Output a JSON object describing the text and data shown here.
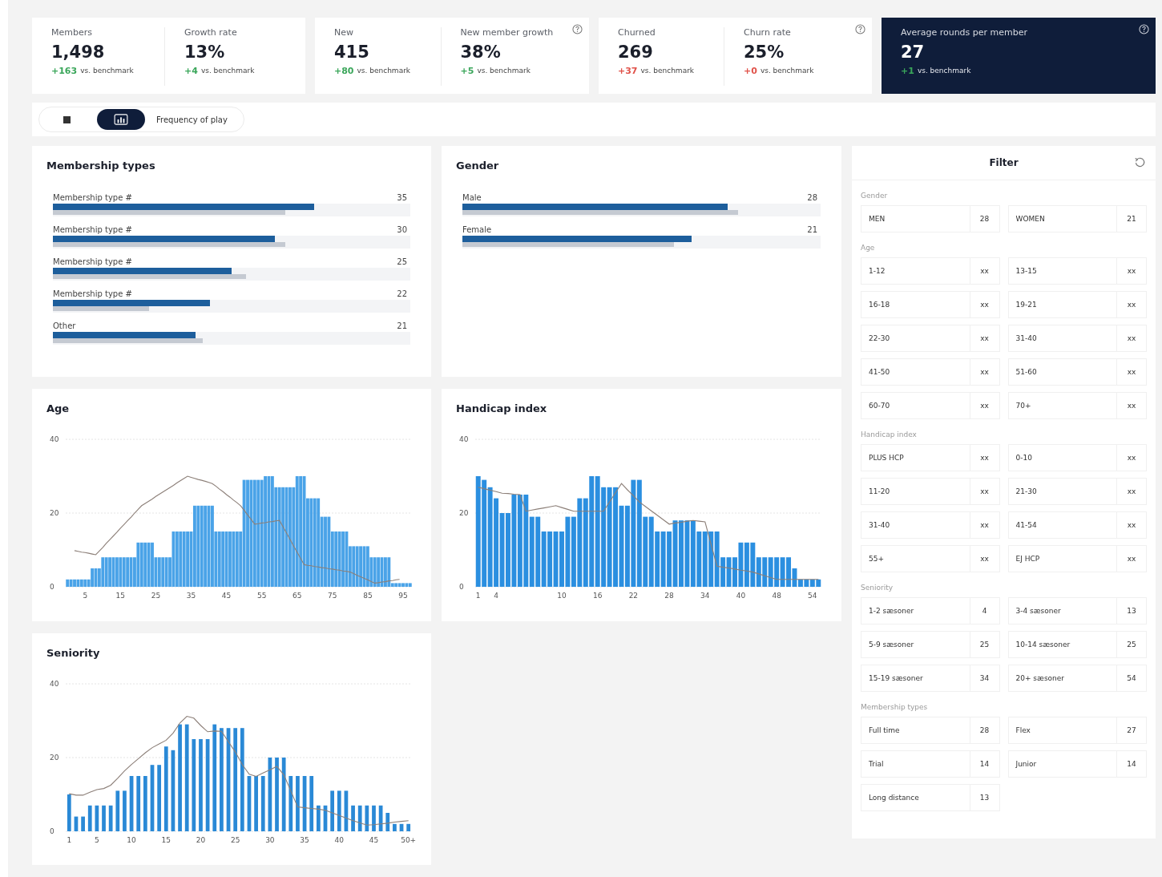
{
  "kpi_cards": [
    {
      "dark": false,
      "info": false,
      "metrics": [
        {
          "label": "Members",
          "value": "1,498",
          "delta": "+163",
          "color": "#3aa65a",
          "caption": "vs. benchmark"
        },
        {
          "label": "Growth rate",
          "value": "13%",
          "delta": "+4",
          "color": "#3aa65a",
          "caption": "vs. benchmark"
        }
      ]
    },
    {
      "dark": false,
      "info": true,
      "metrics": [
        {
          "label": "New",
          "value": "415",
          "delta": "+80",
          "color": "#3aa65a",
          "caption": "vs. benchmark"
        },
        {
          "label": "New member growth",
          "value": "38%",
          "delta": "+5",
          "color": "#3aa65a",
          "caption": "vs. benchmark"
        }
      ]
    },
    {
      "dark": false,
      "info": true,
      "metrics": [
        {
          "label": "Churned",
          "value": "269",
          "delta": "+37",
          "color": "#e0524a",
          "caption": "vs. benchmark"
        },
        {
          "label": "Churn rate",
          "value": "25%",
          "delta": "+0",
          "color": "#e0524a",
          "caption": "vs. benchmark"
        }
      ]
    },
    {
      "dark": true,
      "info": true,
      "metrics": [
        {
          "label": "Average rounds per member",
          "value": "27",
          "delta": "+1",
          "color": "#3aa65a",
          "caption": "vs. benchmark"
        }
      ]
    }
  ],
  "view_tabs": [
    {
      "kind": "list-icon",
      "selected": false
    },
    {
      "kind": "chart-icon",
      "selected": true
    },
    {
      "kind": "text",
      "label": "Frequency of play",
      "selected": false
    }
  ],
  "membership_types": {
    "title": "Membership types",
    "rows": [
      {
        "label": "Membership type #",
        "value": "35",
        "bars": [
          {
            "kind": "current",
            "level": 0.73
          },
          {
            "kind": "benchmark",
            "level": 0.65
          }
        ]
      },
      {
        "label": "Membership type #",
        "value": "30",
        "bars": [
          {
            "kind": "current",
            "level": 0.62
          },
          {
            "kind": "benchmark",
            "level": 0.65
          }
        ]
      },
      {
        "label": "Membership type #",
        "value": "25",
        "bars": [
          {
            "kind": "current",
            "level": 0.5
          },
          {
            "kind": "benchmark",
            "level": 0.54
          }
        ]
      },
      {
        "label": "Membership type #",
        "value": "22",
        "bars": [
          {
            "kind": "current",
            "level": 0.44
          },
          {
            "kind": "benchmark",
            "level": 0.27
          }
        ]
      },
      {
        "label": "Other",
        "value": "21",
        "bars": [
          {
            "kind": "current",
            "level": 0.4
          },
          {
            "kind": "benchmark",
            "level": 0.42
          }
        ]
      }
    ]
  },
  "gender": {
    "title": "Gender",
    "rows": [
      {
        "label": "Male",
        "value": "28",
        "bars": [
          {
            "kind": "current",
            "level": 0.74
          },
          {
            "kind": "benchmark",
            "level": 0.77
          }
        ]
      },
      {
        "label": "Female",
        "value": "21",
        "bars": [
          {
            "kind": "current",
            "level": 0.64
          },
          {
            "kind": "benchmark",
            "level": 0.59
          }
        ]
      }
    ]
  },
  "age": {
    "title": "Age",
    "chart_data": {
      "type": "bar",
      "xlim": [
        -0.5,
        97.5
      ],
      "ylim": [
        0,
        40
      ],
      "yticks": [
        0,
        20,
        40
      ],
      "xticks": [
        5,
        15,
        25,
        35,
        45,
        55,
        65,
        75,
        85,
        95
      ],
      "x": [
        0,
        1,
        2,
        3,
        4,
        5,
        6,
        7,
        8,
        9,
        10,
        11,
        12,
        13,
        14,
        15,
        16,
        17,
        18,
        19,
        20,
        21,
        22,
        23,
        24,
        25,
        26,
        27,
        28,
        29,
        30,
        31,
        32,
        33,
        34,
        35,
        36,
        37,
        38,
        39,
        40,
        41,
        42,
        43,
        44,
        45,
        46,
        47,
        48,
        49,
        50,
        51,
        52,
        53,
        54,
        55,
        56,
        57,
        58,
        59,
        60,
        61,
        62,
        63,
        64,
        65,
        66,
        67,
        68,
        69,
        70,
        71,
        72,
        73,
        74,
        75,
        76,
        77,
        78,
        79,
        80,
        81,
        82,
        83,
        84,
        85,
        86,
        87,
        88,
        89,
        90,
        91,
        92,
        93,
        94,
        95,
        96,
        97
      ],
      "series": [
        {
          "type": "bar",
          "color": "#4aa3e8",
          "values": [
            2,
            2,
            2,
            2,
            2,
            2,
            2,
            5,
            5,
            5,
            8,
            8,
            8,
            8,
            8,
            8,
            8,
            8,
            8,
            8,
            12,
            12,
            12,
            12,
            12,
            8,
            8,
            8,
            8,
            8,
            15,
            15,
            15,
            15,
            15,
            15,
            22,
            22,
            22,
            22,
            22,
            22,
            15,
            15,
            15,
            15,
            15,
            15,
            15,
            15,
            29,
            29,
            29,
            29,
            29,
            29,
            30,
            30,
            30,
            27,
            27,
            27,
            27,
            27,
            27,
            30,
            30,
            30,
            24,
            24,
            24,
            24,
            19,
            19,
            19,
            15,
            15,
            15,
            15,
            15,
            11,
            11,
            11,
            11,
            11,
            11,
            8,
            8,
            8,
            8,
            8,
            8,
            1,
            1,
            1,
            1,
            1,
            1
          ]
        },
        {
          "type": "line",
          "color": "#8c7f78",
          "values": [
            null,
            null,
            9.8,
            9.6,
            9.4,
            9.3,
            9.1,
            8.9,
            8.7,
            9.7,
            10.7,
            11.8,
            12.8,
            13.8,
            14.8,
            15.9,
            16.9,
            17.9,
            18.9,
            20,
            21,
            22,
            22.6,
            23.2,
            23.8,
            24.5,
            25.1,
            25.7,
            26.3,
            26.9,
            27.5,
            28.2,
            28.8,
            29.4,
            30,
            29.7,
            29.4,
            29.1,
            28.9,
            28.6,
            28.3,
            28,
            27.3,
            26.5,
            25.8,
            25,
            24.3,
            23.5,
            22.8,
            22,
            20.8,
            19.5,
            18.3,
            17,
            17.1,
            17.3,
            17.4,
            17.6,
            17.7,
            17.9,
            18,
            16.3,
            14.6,
            12.9,
            11.1,
            9.4,
            7.7,
            6,
            5.8,
            5.7,
            5.5,
            5.4,
            5.2,
            5.1,
            4.9,
            4.8,
            4.6,
            4.5,
            4.3,
            4.2,
            4,
            3.6,
            3.1,
            2.7,
            2.3,
            1.9,
            1.4,
            1,
            1.1,
            1.3,
            1.4,
            1.6,
            1.7,
            1.9,
            2,
            null,
            null,
            null
          ]
        }
      ]
    }
  },
  "handicap_index": {
    "title": "Handicap index",
    "chart_data": {
      "type": "bar",
      "ylim": [
        0,
        40
      ],
      "yticks": [
        0,
        20,
        40
      ],
      "categories": [
        "1",
        null,
        null,
        "4",
        null,
        null,
        null,
        null,
        null,
        null,
        null,
        null,
        null,
        null,
        "10",
        null,
        null,
        null,
        null,
        null,
        "16",
        null,
        null,
        null,
        null,
        null,
        "22",
        null,
        null,
        null,
        null,
        null,
        "28",
        null,
        null,
        null,
        null,
        null,
        "34",
        null,
        null,
        null,
        null,
        null,
        "40",
        null,
        null,
        null,
        null,
        null,
        "48",
        null,
        null,
        null,
        null,
        null,
        "54",
        null
      ],
      "series": [
        {
          "type": "bar",
          "color": "#2b8fe0",
          "values": [
            30,
            29,
            27,
            24,
            20,
            20,
            25,
            25,
            25,
            19,
            19,
            15,
            15,
            15,
            15,
            19,
            19,
            24,
            24,
            30,
            30,
            27,
            27,
            27,
            22,
            22,
            29,
            29,
            19,
            19,
            15,
            15,
            15,
            18,
            18,
            18,
            18,
            15,
            15,
            15,
            15,
            8,
            8,
            8,
            12,
            12,
            12,
            8,
            8,
            8,
            8,
            8,
            8,
            5,
            2,
            2,
            2,
            2
          ]
        },
        {
          "type": "line",
          "color": "#8c7f78",
          "values": [
            27,
            26.6,
            26.2,
            25.8,
            25.4,
            25.3,
            25.1,
            25,
            20.5,
            20.8,
            21.1,
            21.4,
            21.7,
            22,
            21.5,
            21,
            20.5,
            20.5,
            20.5,
            20.5,
            20.5,
            20.5,
            23,
            25.5,
            28,
            26.3,
            24.7,
            23,
            21.8,
            20.6,
            19.4,
            18.2,
            17,
            17.3,
            17.5,
            17.8,
            18,
            17.8,
            17.6,
            11.6,
            5.6,
            5.3,
            5.1,
            4.8,
            4.5,
            4.3,
            4,
            3.5,
            3,
            2.5,
            2,
            2,
            2,
            2,
            2,
            2,
            2,
            2
          ]
        }
      ]
    }
  },
  "seniority": {
    "title": "Seniority",
    "chart_data": {
      "type": "bar",
      "xlim": [
        0.5,
        50.5
      ],
      "ylim": [
        0,
        40
      ],
      "yticks": [
        0,
        20,
        40
      ],
      "xticks": [
        1,
        5,
        10,
        15,
        20,
        25,
        30,
        35,
        40,
        45,
        {
          "value": 50,
          "label": "50+"
        }
      ],
      "x": [
        1,
        2,
        3,
        4,
        5,
        6,
        7,
        8,
        9,
        10,
        11,
        12,
        13,
        14,
        15,
        16,
        17,
        18,
        19,
        20,
        21,
        22,
        23,
        24,
        25,
        26,
        27,
        28,
        29,
        30,
        31,
        32,
        33,
        34,
        35,
        36,
        37,
        38,
        39,
        40,
        41,
        42,
        43,
        44,
        45,
        46,
        47,
        48,
        49,
        50
      ],
      "series": [
        {
          "type": "bar",
          "color": "#2a89d6",
          "values": [
            10,
            4,
            4,
            7,
            7,
            7,
            7,
            11,
            11,
            15,
            15,
            15,
            18,
            18,
            23,
            22,
            29,
            29,
            25,
            25,
            25,
            29,
            28,
            28,
            28,
            28,
            15,
            15,
            15,
            20,
            20,
            20,
            15,
            15,
            15,
            15,
            7,
            7,
            11,
            11,
            11,
            7,
            7,
            7,
            7,
            7,
            5,
            2,
            2,
            2
          ]
        },
        {
          "type": "line",
          "color": "#8c7f78",
          "values": [
            10.2,
            9.8,
            9.8,
            10.6,
            11.3,
            11.6,
            12.5,
            14.4,
            16.4,
            18.1,
            19.7,
            21.3,
            22.7,
            23.7,
            24.7,
            26.6,
            29.4,
            31.2,
            30.7,
            28.7,
            27,
            27.2,
            27.1,
            24.3,
            21.5,
            18.1,
            15.5,
            14.9,
            15.8,
            16.7,
            17.6,
            15.3,
            11,
            6.6,
            6.4,
            6.2,
            6,
            5.7,
            5,
            4.3,
            3.6,
            2.9,
            2.3,
            1.7,
            1.8,
            2,
            2.2,
            2.5,
            2.7,
            2.9
          ]
        }
      ]
    }
  },
  "filter": {
    "title": "Filter",
    "sections": [
      {
        "label": "Gender",
        "options": [
          {
            "label": "MEN",
            "count": "28"
          },
          {
            "label": "WOMEN",
            "count": "21"
          }
        ]
      },
      {
        "label": "Age",
        "options": [
          {
            "label": "1-12",
            "count": "xx"
          },
          {
            "label": "13-15",
            "count": "xx"
          },
          {
            "label": "16-18",
            "count": "xx"
          },
          {
            "label": "19-21",
            "count": "xx"
          },
          {
            "label": "22-30",
            "count": "xx"
          },
          {
            "label": "31-40",
            "count": "xx"
          },
          {
            "label": "41-50",
            "count": "xx"
          },
          {
            "label": "51-60",
            "count": "xx"
          },
          {
            "label": "60-70",
            "count": "xx"
          },
          {
            "label": "70+",
            "count": "xx"
          }
        ]
      },
      {
        "label": "Handicap index",
        "options": [
          {
            "label": "PLUS HCP",
            "count": "xx"
          },
          {
            "label": "0-10",
            "count": "xx"
          },
          {
            "label": "11-20",
            "count": "xx"
          },
          {
            "label": "21-30",
            "count": "xx"
          },
          {
            "label": "31-40",
            "count": "xx"
          },
          {
            "label": "41-54",
            "count": "xx"
          },
          {
            "label": "55+",
            "count": "xx"
          },
          {
            "label": "EJ HCP",
            "count": "xx"
          }
        ]
      },
      {
        "label": "Seniority",
        "options": [
          {
            "label": "1-2 sæsoner",
            "count": "4"
          },
          {
            "label": "3-4 sæsoner",
            "count": "13"
          },
          {
            "label": "5-9 sæsoner",
            "count": "25"
          },
          {
            "label": "10-14 sæsoner",
            "count": "25"
          },
          {
            "label": "15-19 sæsoner",
            "count": "34"
          },
          {
            "label": "20+ sæsoner",
            "count": "54"
          }
        ]
      },
      {
        "label": "Membership types",
        "options": [
          {
            "label": "Full time",
            "count": "28"
          },
          {
            "label": "Flex",
            "count": "27"
          },
          {
            "label": "Trial",
            "count": "14"
          },
          {
            "label": "Junior",
            "count": "14"
          },
          {
            "label": "Long distance",
            "count": "13"
          }
        ]
      }
    ]
  }
}
